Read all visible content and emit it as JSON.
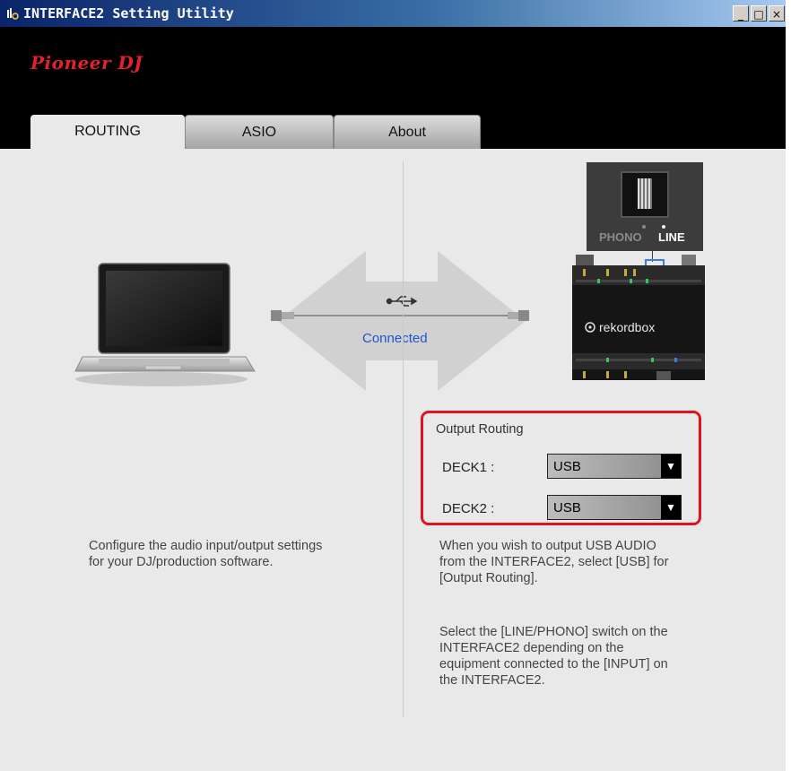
{
  "window": {
    "title": "INTERFACE2 Setting Utility",
    "min_label": "_",
    "max_label": "□",
    "close_label": "×"
  },
  "header": {
    "logo_text": "Pioneer DJ"
  },
  "tabs": [
    {
      "label": "ROUTING",
      "active": true
    },
    {
      "label": "ASIO",
      "active": false
    },
    {
      "label": "About",
      "active": false
    }
  ],
  "routing": {
    "connection_status": "Connected",
    "left_description": [
      "Configure the audio input/output settings",
      "for your DJ/production software."
    ],
    "switch_labels": {
      "phono": "PHONO",
      "line": "LINE"
    },
    "device_brand": "rekordbox",
    "output_routing": {
      "title": "Output Routing",
      "decks": [
        {
          "label": "DECK1 :",
          "value": "USB"
        },
        {
          "label": "DECK2 :",
          "value": "USB"
        }
      ]
    },
    "help_text_1": [
      "When you wish to output USB AUDIO",
      "from the INTERFACE2, select [USB] for",
      "[Output Routing]."
    ],
    "help_text_2": [
      "Select the [LINE/PHONO] switch on the",
      "INTERFACE2 depending on  the",
      "equipment connected to the [INPUT] on",
      "the INTERFACE2."
    ]
  },
  "colors": {
    "accent_red": "#e0141e",
    "connected_blue": "#2255cc",
    "logo_red": "#e4212a"
  }
}
